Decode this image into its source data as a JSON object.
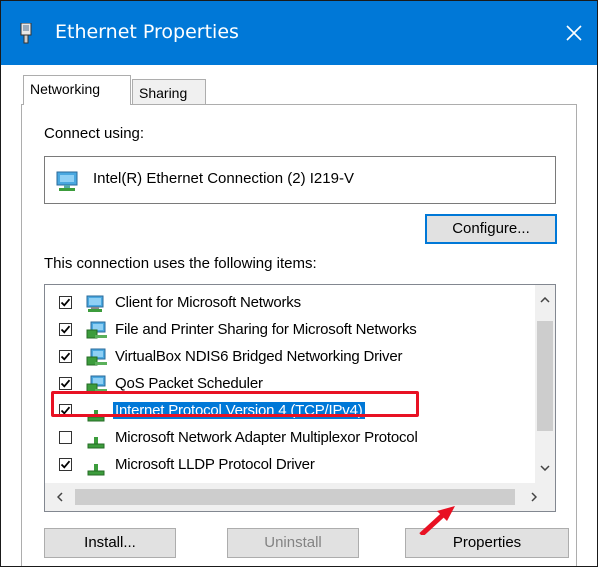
{
  "window": {
    "title": "Ethernet Properties"
  },
  "tabs": [
    {
      "label": "Networking",
      "active": true
    },
    {
      "label": "Sharing",
      "active": false
    }
  ],
  "connect_using_label": "Connect using:",
  "adapter_name": "Intel(R) Ethernet Connection (2) I219-V",
  "buttons": {
    "configure": "Configure...",
    "install": "Install...",
    "uninstall": "Uninstall",
    "properties": "Properties"
  },
  "items_label": "This connection uses the following items:",
  "items": [
    {
      "label": "Client for Microsoft Networks",
      "checked": true,
      "icon": "network-client-icon"
    },
    {
      "label": "File and Printer Sharing for Microsoft Networks",
      "checked": true,
      "icon": "network-service-icon"
    },
    {
      "label": "VirtualBox NDIS6 Bridged Networking Driver",
      "checked": true,
      "icon": "network-service-icon"
    },
    {
      "label": "QoS Packet Scheduler",
      "checked": true,
      "icon": "network-service-icon"
    },
    {
      "label": "Internet Protocol Version 4 (TCP/IPv4)",
      "checked": true,
      "icon": "protocol-icon",
      "selected": true
    },
    {
      "label": "Microsoft Network Adapter Multiplexor Protocol",
      "checked": false,
      "icon": "protocol-icon"
    },
    {
      "label": "Microsoft LLDP Protocol Driver",
      "checked": true,
      "icon": "protocol-icon"
    }
  ],
  "colors": {
    "titlebar": "#0078d7",
    "selection": "#0078d7",
    "highlight": "#e81123"
  }
}
